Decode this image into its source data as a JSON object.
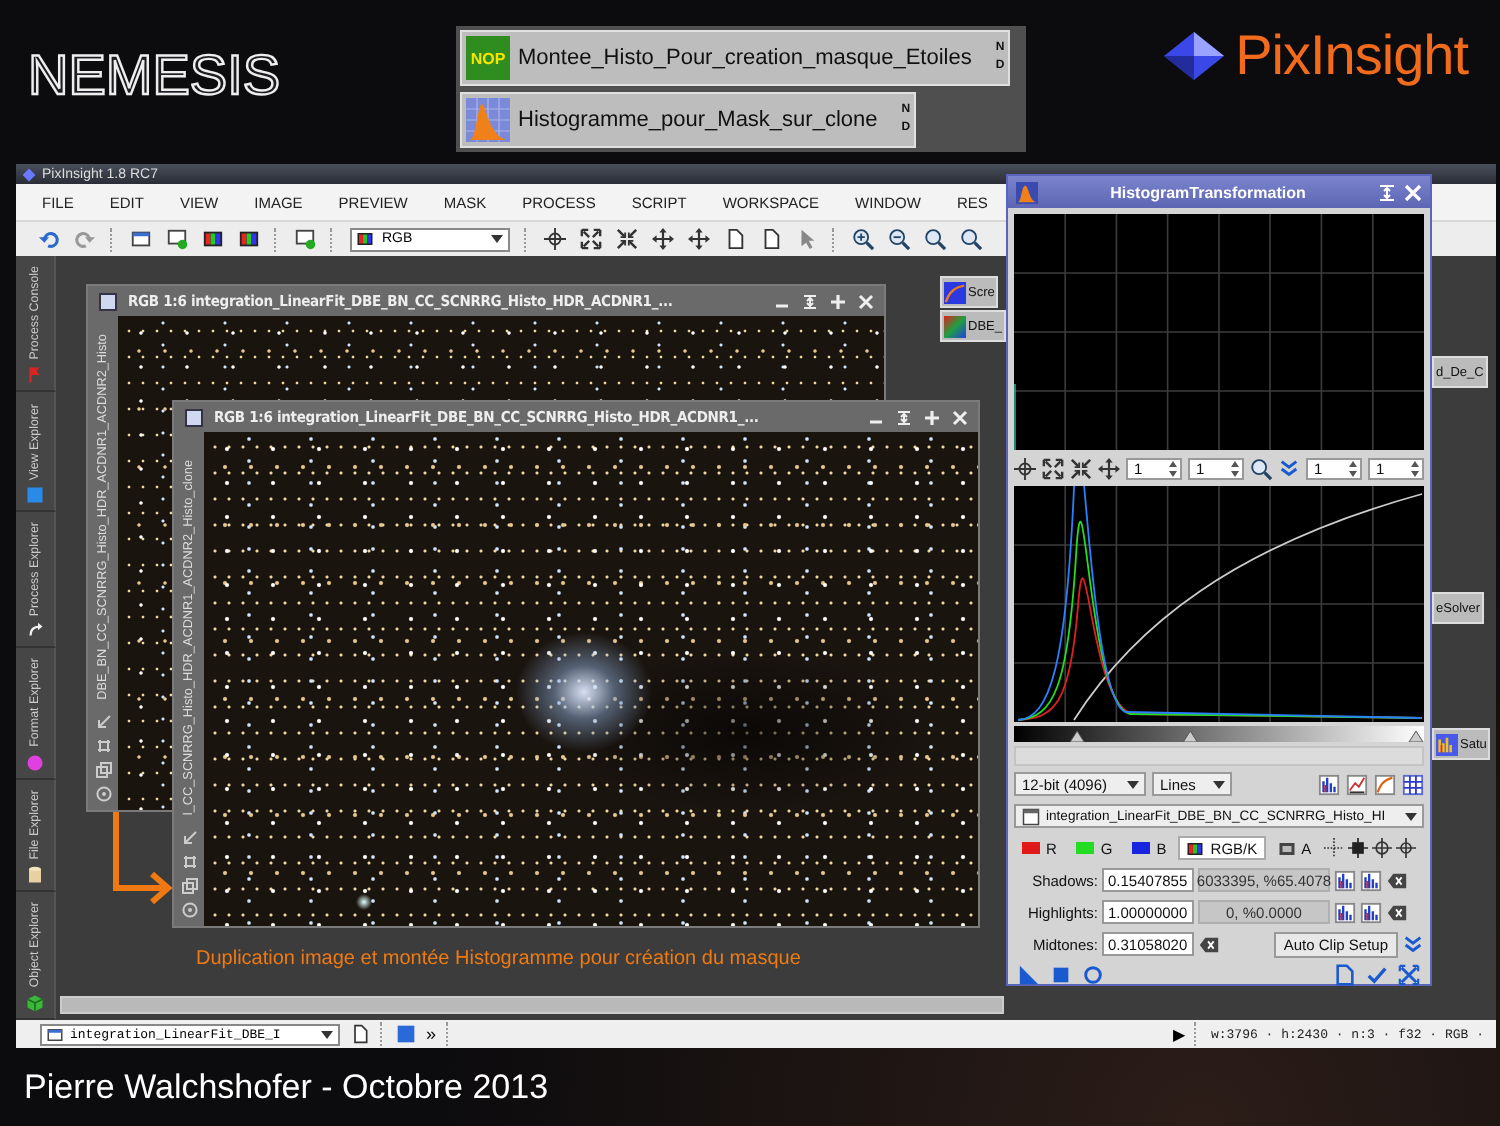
{
  "logo": {
    "text": "NEMESIS"
  },
  "process_icons": [
    {
      "kind": "nop",
      "badge": "NOP",
      "label": "Montee_Histo_Pour_creation_masque_Etoiles",
      "flags": [
        "N",
        "D"
      ]
    },
    {
      "kind": "histogram",
      "label": "Histogramme_pour_Mask_sur_clone",
      "flags": [
        "N",
        "D"
      ]
    }
  ],
  "brand": {
    "text": "PixInsight"
  },
  "app": {
    "title": "PixInsight 1.8 RC7",
    "menu": [
      "FILE",
      "EDIT",
      "VIEW",
      "IMAGE",
      "PREVIEW",
      "MASK",
      "PROCESS",
      "SCRIPT",
      "WORKSPACE",
      "WINDOW",
      "RES"
    ],
    "color_space": "RGB",
    "side_tabs": [
      {
        "label": "Process Console",
        "kind": "console"
      },
      {
        "label": "View Explorer",
        "kind": "view"
      },
      {
        "label": "Process Explorer",
        "kind": "process"
      },
      {
        "label": "Format Explorer",
        "kind": "format"
      },
      {
        "label": "File Explorer",
        "kind": "file"
      },
      {
        "label": "Object Explorer",
        "kind": "object"
      }
    ],
    "image_windows": [
      {
        "title": "RGB 1:6 integration_LinearFit_DBE_BN_CC_SCNRRG_Histo_HDR_ACDNR1_...",
        "side_label": "DBE_BN_CC_SCNRRG_Histo_HDR_ACDNR1_ACDNR2_Histo"
      },
      {
        "title": "RGB 1:6 integration_LinearFit_DBE_BN_CC_SCNRRG_Histo_HDR_ACDNR1_...",
        "side_label": "l_CC_SCNRRG_Histo_HDR_ACDNR1_ACDNR2_Histo_clone"
      }
    ],
    "workspace_icons": [
      {
        "label": "Scre",
        "kind": "curves"
      },
      {
        "label": "DBE_",
        "kind": "dbe"
      },
      {
        "label": "d_De_C",
        "kind": "plain"
      },
      {
        "label": "eSolver",
        "kind": "plain"
      },
      {
        "label": "Satu",
        "kind": "saturation"
      }
    ],
    "annotation": "Duplication image et montée Histogramme pour création du masque",
    "status_bar": {
      "view": "integration_LinearFit_DBE_I",
      "more": "»",
      "play": "▶",
      "info": "w:3796 · h:2430 · n:3 · f32 · RGB ·"
    }
  },
  "histogram": {
    "title": "HistogramTransformation",
    "zoom": [
      "1",
      "1",
      "1",
      "1"
    ],
    "resolution": "12-bit (4096)",
    "graph_style": "Lines",
    "view": "integration_LinearFit_DBE_BN_CC_SCNRRG_Histo_HI",
    "channels": [
      {
        "label": "R",
        "kind": "swatch",
        "color": "#e01818",
        "selected": false
      },
      {
        "label": "G",
        "kind": "swatch",
        "color": "#22dd22",
        "selected": false
      },
      {
        "label": "B",
        "kind": "swatch",
        "color": "#1824e0",
        "selected": false
      },
      {
        "label": "RGB/K",
        "kind": "rgb",
        "selected": true
      },
      {
        "label": "A",
        "kind": "alpha",
        "selected": false
      }
    ],
    "levels": [
      {
        "kind": "clip",
        "label": "Shadows:",
        "value": "0.15407855",
        "count": "6033395, %65.4078",
        "level": 0.154
      },
      {
        "kind": "clip",
        "label": "Highlights:",
        "value": "1.00000000",
        "count": "0, %0.0000",
        "level": 1
      },
      {
        "kind": "midtones",
        "label": "Midtones:",
        "value": "0.31058020",
        "button": "Auto Clip Setup",
        "level": 0.43
      }
    ]
  },
  "credit": "Pierre Walchshofer - Octobre 2013"
}
